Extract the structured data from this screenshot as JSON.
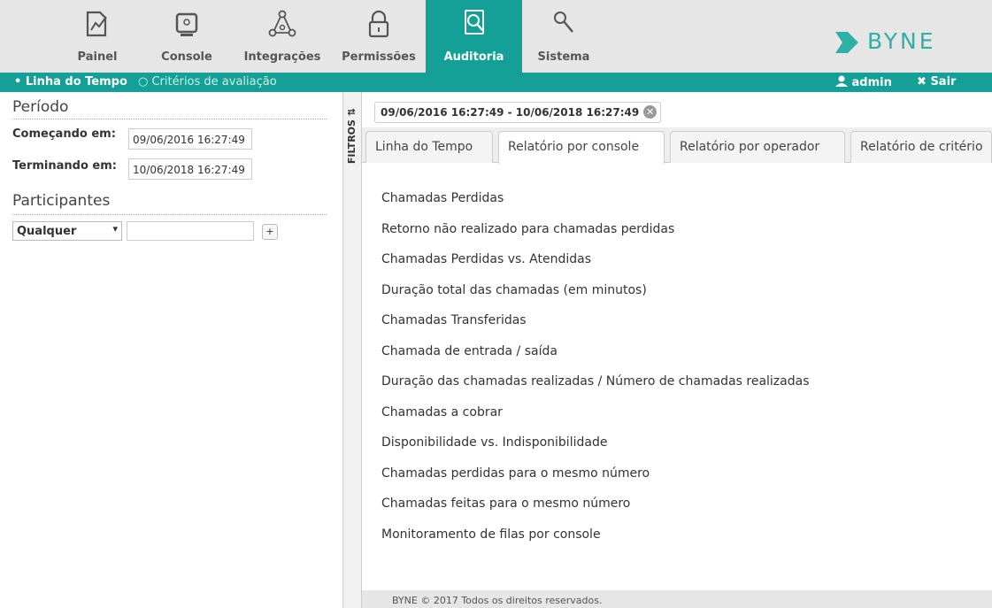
{
  "nav": {
    "items": [
      {
        "label": "Painel",
        "icon": "chart-icon"
      },
      {
        "label": "Console",
        "icon": "console-icon"
      },
      {
        "label": "Integrações",
        "icon": "network-icon"
      },
      {
        "label": "Permissões",
        "icon": "lock-icon"
      },
      {
        "label": "Auditoria",
        "icon": "audit-search-icon"
      },
      {
        "label": "Sistema",
        "icon": "wrench-icon"
      }
    ],
    "active": "Auditoria",
    "logo_text": "BYNE"
  },
  "subbar": {
    "timeline": "• Linha do Tempo",
    "criteria": "○ Critérios de avaliação",
    "user": "admin",
    "logout": "Sair"
  },
  "filters": {
    "period_title": "Período",
    "start_label": "Começando em:",
    "start_value": "09/06/2016 16:27:49",
    "end_label": "Terminando em:",
    "end_value": "10/06/2018 16:27:49",
    "participants_title": "Participantes",
    "participant_select": "Qualquer",
    "add_label": "+",
    "toggle_label": "FILTROS"
  },
  "main": {
    "date_range": "09/06/2016 16:27:49 - 10/06/2018 16:27:49",
    "tabs": [
      {
        "label": "Linha do Tempo"
      },
      {
        "label": "Relatório por console"
      },
      {
        "label": "Relatório por operador"
      },
      {
        "label": "Relatório de critério"
      }
    ],
    "active_tab": "Relatório por console",
    "reports": [
      "Chamadas Perdidas",
      "Retorno não realizado para chamadas perdidas",
      "Chamadas Perdidas vs. Atendidas",
      "Duração total das chamadas (em minutos)",
      "Chamadas Transferidas",
      "Chamada de entrada / saída",
      "Duração das chamadas realizadas / Número de chamadas realizadas",
      "Chamadas a cobrar",
      "Disponibilidade vs. Indisponibilidade",
      "Chamadas perdidas para o mesmo número",
      "Chamadas feitas para o mesmo número",
      "Monitoramento de filas por console"
    ],
    "footer": "BYNE © 2017 Todos os direitos reservados."
  },
  "colors": {
    "accent": "#14a096",
    "logo": "#2db0a5",
    "nav_bg": "#e6e6e6"
  }
}
